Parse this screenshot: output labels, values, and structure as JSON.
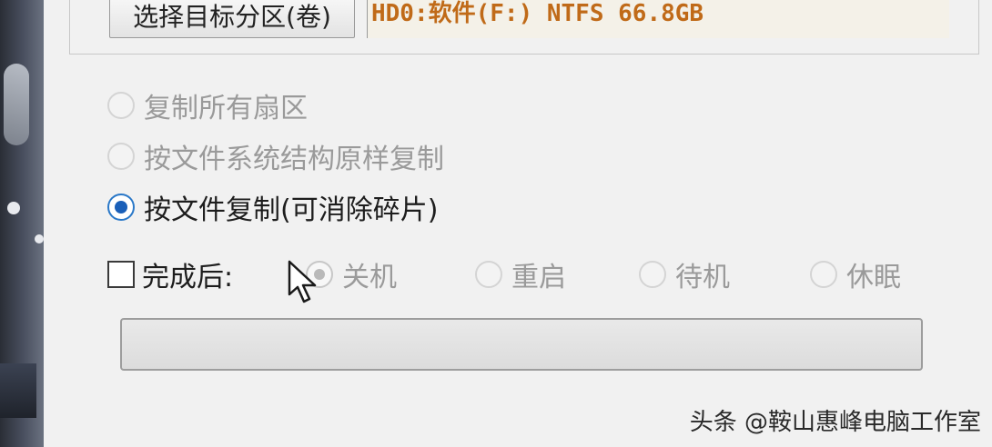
{
  "top": {
    "select_button": "选择目标分区(卷)",
    "partition_info": "HD0:软件(F:) NTFS 66.8GB"
  },
  "copy_options": [
    {
      "label": "复制所有扇区",
      "state": "disabled"
    },
    {
      "label": "按文件系统结构原样复制",
      "state": "disabled"
    },
    {
      "label": "按文件复制(可消除碎片)",
      "state": "checked"
    }
  ],
  "after_complete": {
    "checkbox_label": "完成后:",
    "checked": false,
    "options": [
      {
        "label": "关机",
        "state": "checked-disabled"
      },
      {
        "label": "重启",
        "state": "unchecked"
      },
      {
        "label": "待机",
        "state": "unchecked"
      },
      {
        "label": "休眠",
        "state": "unchecked"
      }
    ]
  },
  "progress": {
    "value": 0
  },
  "watermark": "头条 @鞍山惠峰电脑工作室",
  "colors": {
    "partition_text": "#c06a18",
    "radio_checked": "#1a5fb8"
  }
}
